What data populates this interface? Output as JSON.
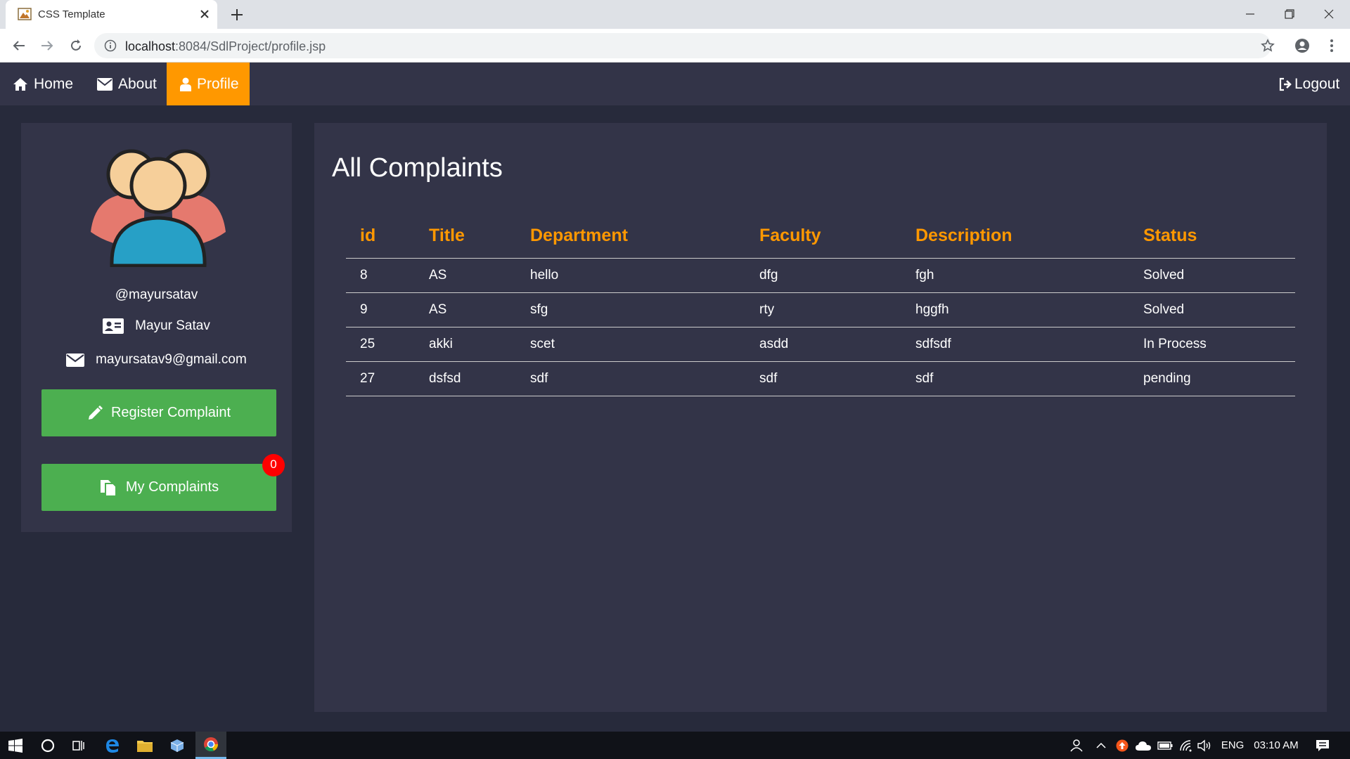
{
  "browser": {
    "tab_title": "CSS Template",
    "url_host": "localhost",
    "url_path": ":8084/SdlProject/profile.jsp"
  },
  "nav": {
    "home": "Home",
    "about": "About",
    "profile": "Profile",
    "logout": "Logout"
  },
  "sidebar": {
    "handle": "@mayursatav",
    "name": "Mayur Satav",
    "email": "mayursatav9@gmail.com",
    "register_label": "Register Complaint",
    "my_complaints_label": "My Complaints",
    "badge_count": "0"
  },
  "main": {
    "heading": "All Complaints",
    "columns": [
      "id",
      "Title",
      "Department",
      "Faculty",
      "Description",
      "Status"
    ],
    "rows": [
      [
        "8",
        "AS",
        "hello",
        "dfg",
        "fgh",
        "Solved"
      ],
      [
        "9",
        "AS",
        "sfg",
        "rty",
        "hggfh",
        "Solved"
      ],
      [
        "25",
        "akki",
        "scet",
        "asdd",
        "sdfsdf",
        "In Process"
      ],
      [
        "27",
        "dsfsd",
        "sdf",
        "sdf",
        "sdf",
        "pending"
      ]
    ]
  },
  "taskbar": {
    "lang": "ENG",
    "time": "03:10 AM"
  },
  "colors": {
    "accent": "#ff9800",
    "panel": "#333448",
    "page_bg": "#272a3b",
    "button": "#4caf50",
    "badge": "#ff0000"
  },
  "icons": [
    "home-icon",
    "envelope-icon",
    "user-icon",
    "logout-icon",
    "id-card-icon",
    "pencil-icon",
    "copy-icon",
    "users-avatar"
  ]
}
